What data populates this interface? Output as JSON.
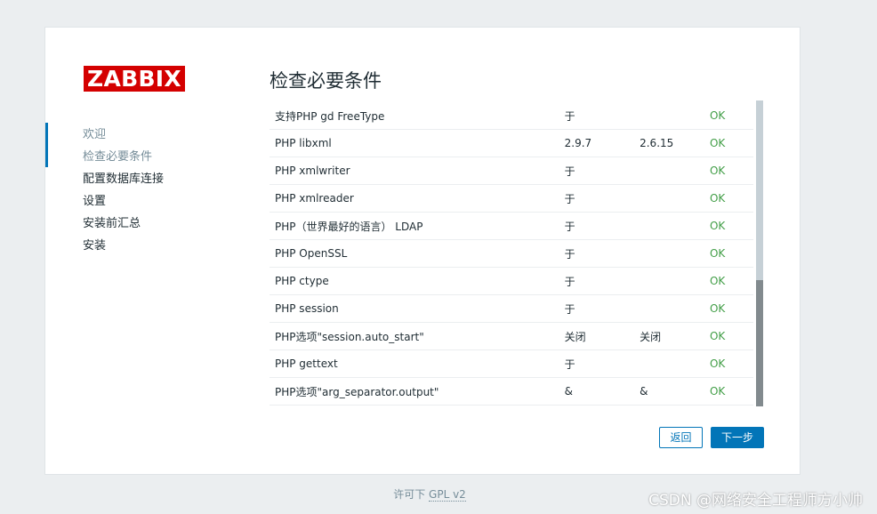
{
  "logo": {
    "text": "ZABBIX",
    "color": "#d40000"
  },
  "sidebar": {
    "steps": [
      {
        "label": "欢迎",
        "state": "done"
      },
      {
        "label": "检查必要条件",
        "state": "current"
      },
      {
        "label": "配置数据库连接",
        "state": "todo"
      },
      {
        "label": "设置",
        "state": "todo"
      },
      {
        "label": "安装前汇总",
        "state": "todo"
      },
      {
        "label": "安装",
        "state": "todo"
      }
    ]
  },
  "main": {
    "title": "检查必要条件",
    "rows": [
      {
        "name": "支持PHP gd FreeType",
        "current": "于",
        "required": "",
        "status": "OK"
      },
      {
        "name": "PHP libxml",
        "current": "2.9.7",
        "required": "2.6.15",
        "status": "OK"
      },
      {
        "name": "PHP xmlwriter",
        "current": "于",
        "required": "",
        "status": "OK"
      },
      {
        "name": "PHP xmlreader",
        "current": "于",
        "required": "",
        "status": "OK"
      },
      {
        "name": "PHP（世界最好的语言） LDAP",
        "current": "于",
        "required": "",
        "status": "OK"
      },
      {
        "name": "PHP OpenSSL",
        "current": "于",
        "required": "",
        "status": "OK"
      },
      {
        "name": "PHP ctype",
        "current": "于",
        "required": "",
        "status": "OK"
      },
      {
        "name": "PHP session",
        "current": "于",
        "required": "",
        "status": "OK"
      },
      {
        "name": "PHP选项\"session.auto_start\"",
        "current": "关闭",
        "required": "关闭",
        "status": "OK"
      },
      {
        "name": "PHP gettext",
        "current": "于",
        "required": "",
        "status": "OK"
      },
      {
        "name": "PHP选项\"arg_separator.output\"",
        "current": "&",
        "required": "&",
        "status": "OK"
      }
    ],
    "scroll_position": 0.59
  },
  "buttons": {
    "back": "返回",
    "next": "下一步"
  },
  "footer": {
    "prefix": "许可下",
    "link": "GPL v2"
  },
  "watermark": "CSDN @网络安全工程师方小帅",
  "colors": {
    "accent": "#0275b8",
    "ok": "#429e47",
    "muted": "#768d99",
    "background": "#ebeef0"
  }
}
